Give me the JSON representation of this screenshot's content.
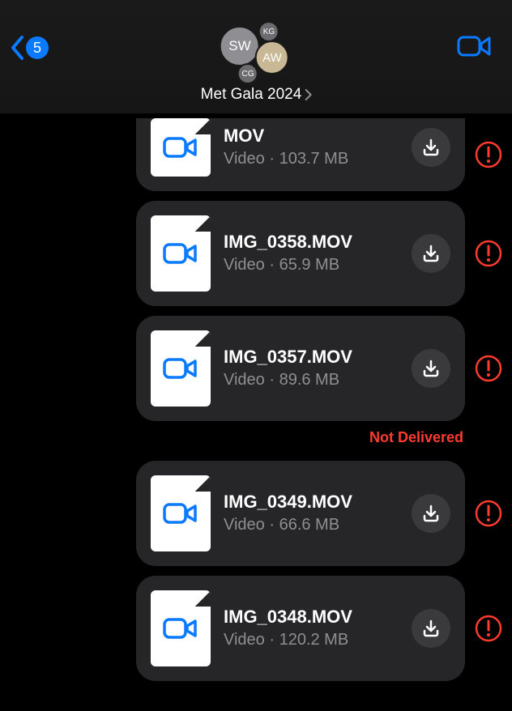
{
  "header": {
    "unread_count": "5",
    "group_name": "Met Gala 2024",
    "avatars": {
      "sw": "SW",
      "kg": "KG",
      "aw": "AW",
      "cg": "CG"
    }
  },
  "status_text": {
    "not_delivered": "Not Delivered"
  },
  "messages": [
    {
      "filename": "MOV",
      "type": "Video",
      "size": "103.7 MB",
      "truncated": "top"
    },
    {
      "filename": "IMG_0358.MOV",
      "type": "Video",
      "size": "65.9 MB"
    },
    {
      "filename": "IMG_0357.MOV",
      "type": "Video",
      "size": "89.6 MB",
      "show_not_delivered_after": true
    },
    {
      "filename": "IMG_0349.MOV",
      "type": "Video",
      "size": "66.6 MB"
    },
    {
      "filename": "IMG_0348.MOV",
      "type": "Video",
      "size": "120.2 MB",
      "truncated": "bottom"
    }
  ],
  "colors": {
    "accent": "#0a7aff",
    "error": "#ff3b30"
  }
}
